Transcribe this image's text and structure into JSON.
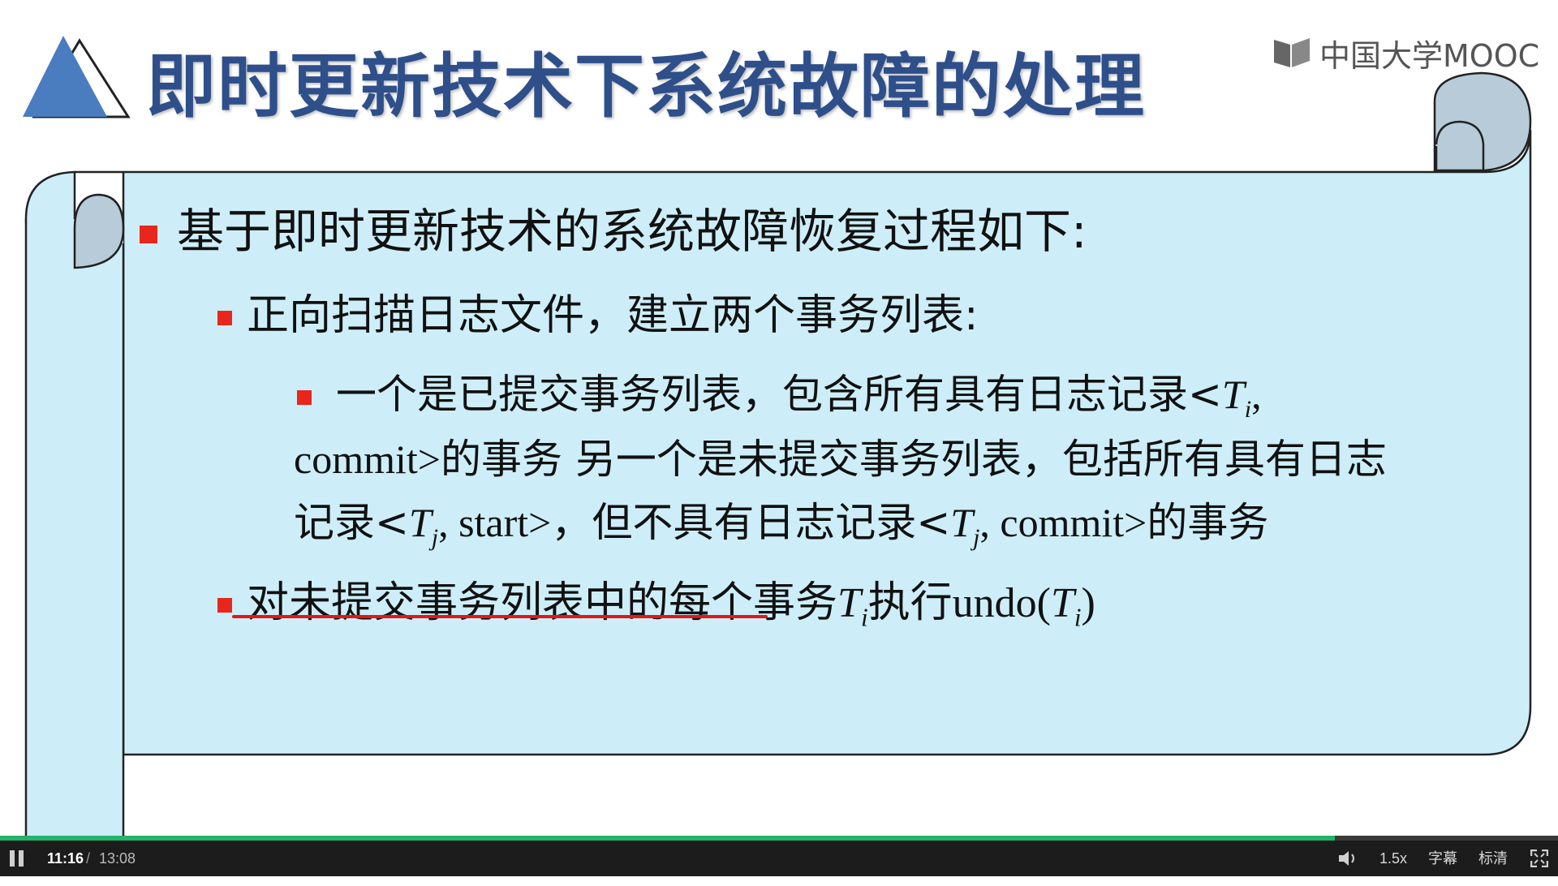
{
  "slide": {
    "title": "即时更新技术下系统故障的处理",
    "logo_text": "中国大学MOOC",
    "bullets": {
      "b1": "基于即时更新技术的系统故障恢复过程如下:",
      "b2": "正向扫描日志文件，建立两个事务列表:",
      "b3_line1_text": "一个是已提交事务列表，包含所有具有日志记录<",
      "b3_line1_var": "T",
      "b3_line1_sub": "i",
      "b3_line1_end": ",",
      "b3_line2_a": "commit>",
      "b3_line2_b": "的事务 另一个是未提交事务列表，包括所有具有日志",
      "b3_line3_a": "记录<",
      "b3_line3_var1": "T",
      "b3_line3_sub1": "j",
      "b3_line3_b": ", start>",
      "b3_line3_c": "，但不具有日志记录<",
      "b3_line3_var2": "T",
      "b3_line3_sub2": "j",
      "b3_line3_d": ", commit>",
      "b3_line3_e": "的事务",
      "b4_text": "对未提交事务列表中的每个事务",
      "b4_var": "T",
      "b4_sub": "i",
      "b4_exec": "执行",
      "b4_undo": "undo(",
      "b4_var2": "T",
      "b4_sub2": "i",
      "b4_close": ")"
    }
  },
  "player": {
    "current_time": "11:16",
    "separator": "/",
    "total_time": "13:08",
    "progress": 0.857,
    "rate": "1.5x",
    "subtitles": "字幕",
    "quality": "标清",
    "icons": [
      "pause-icon",
      "volume-icon",
      "fullscreen-icon"
    ]
  },
  "colors": {
    "title": "#2e4f8a",
    "scroll_fill": "#cdeef8",
    "scroll_curl": "#b7ccd8",
    "bullet": "#e8261c",
    "underline": "#e01818",
    "progress": "#23b36b"
  }
}
